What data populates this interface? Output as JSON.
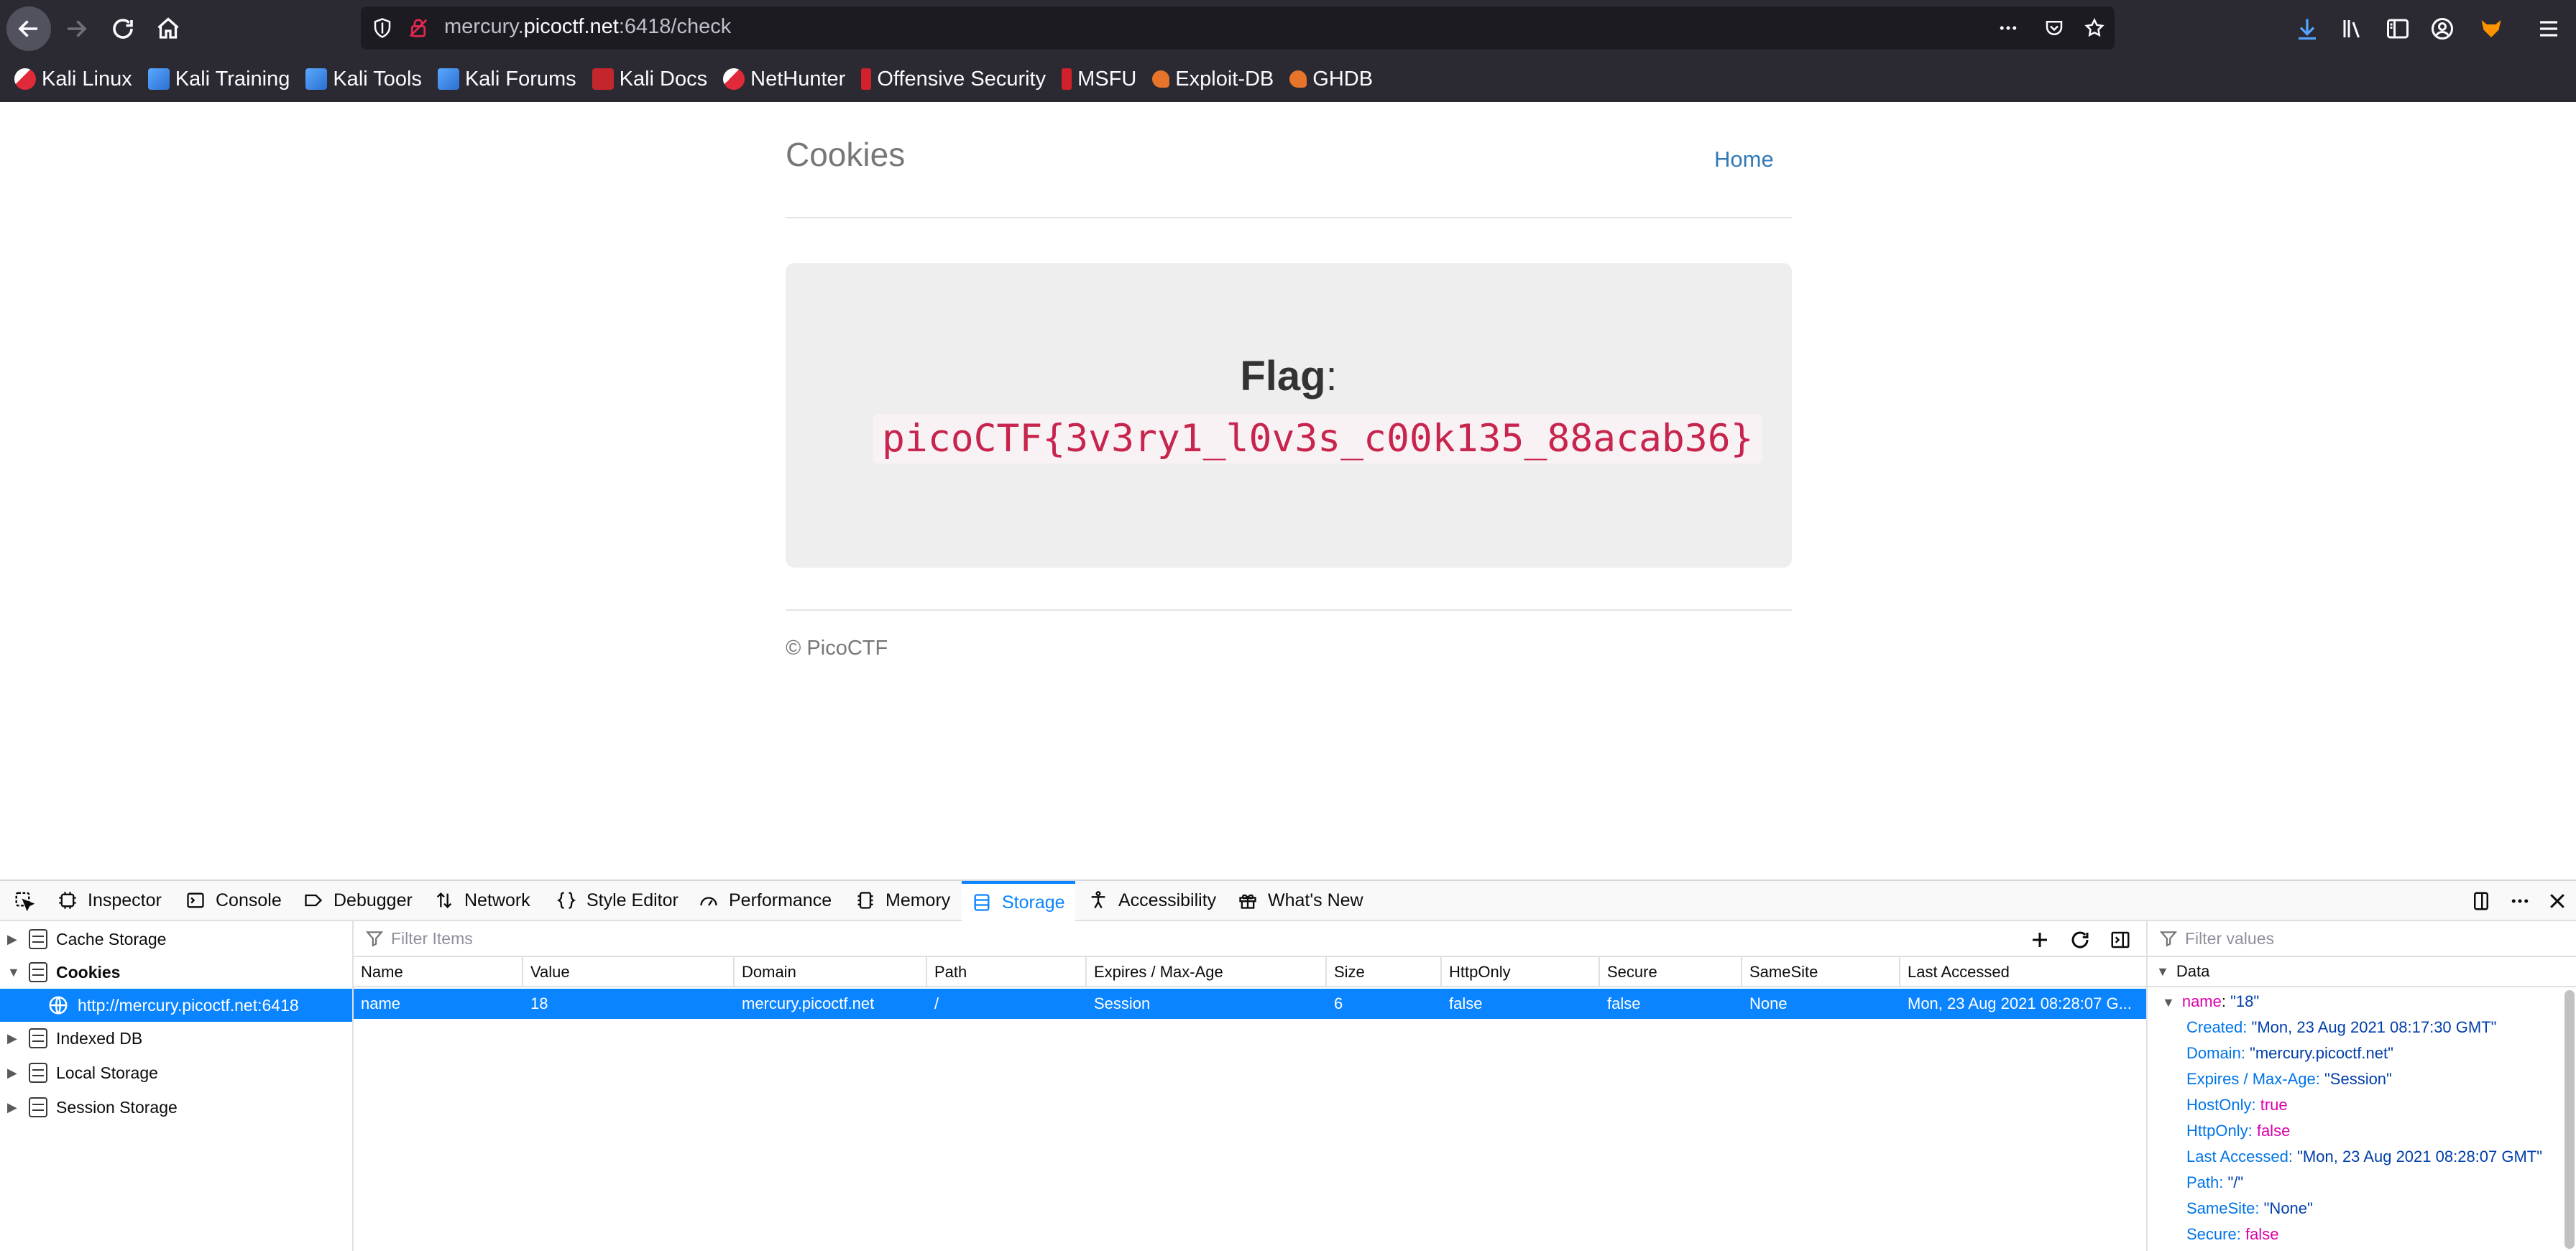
{
  "browser": {
    "url_prefix": "mercury.",
    "url_domain": "picoctf.net",
    "url_suffix": ":6418/check",
    "bookmarks": [
      {
        "label": "Kali Linux",
        "icon": "kali-dragon-icon"
      },
      {
        "label": "Kali Training",
        "icon": "kali-training-icon"
      },
      {
        "label": "Kali Tools",
        "icon": "kali-tools-icon"
      },
      {
        "label": "Kali Forums",
        "icon": "kali-forums-icon"
      },
      {
        "label": "Kali Docs",
        "icon": "kali-docs-icon"
      },
      {
        "label": "NetHunter",
        "icon": "nethunter-icon"
      },
      {
        "label": "Offensive Security",
        "icon": "offsec-icon"
      },
      {
        "label": "MSFU",
        "icon": "msfu-icon"
      },
      {
        "label": "Exploit-DB",
        "icon": "exploit-db-icon"
      },
      {
        "label": "GHDB",
        "icon": "ghdb-icon"
      }
    ]
  },
  "page": {
    "site_title": "Cookies",
    "nav_home": "Home",
    "flag_label": "Flag",
    "flag_colon": ":",
    "flag_value": "picoCTF{3v3ry1_l0v3s_c00k135_88acab36}",
    "footer": "© PicoCTF"
  },
  "devtools": {
    "tabs": [
      {
        "label": "Inspector",
        "icon": "inspector-icon"
      },
      {
        "label": "Console",
        "icon": "console-icon"
      },
      {
        "label": "Debugger",
        "icon": "debugger-icon"
      },
      {
        "label": "Network",
        "icon": "network-icon"
      },
      {
        "label": "Style Editor",
        "icon": "style-editor-icon"
      },
      {
        "label": "Performance",
        "icon": "performance-icon"
      },
      {
        "label": "Memory",
        "icon": "memory-icon"
      },
      {
        "label": "Storage",
        "icon": "storage-icon",
        "active": true
      },
      {
        "label": "Accessibility",
        "icon": "accessibility-icon"
      },
      {
        "label": "What's New",
        "icon": "whats-new-icon"
      }
    ],
    "sidebar": {
      "cache_storage": "Cache Storage",
      "cookies": "Cookies",
      "cookie_origin": "http://mercury.picoctf.net:6418",
      "indexed_db": "Indexed DB",
      "local_storage": "Local Storage",
      "session_storage": "Session Storage"
    },
    "filter_placeholder": "Filter Items",
    "data_filter_placeholder": "Filter values",
    "columns": [
      "Name",
      "Value",
      "Domain",
      "Path",
      "Expires / Max-Age",
      "Size",
      "HttpOnly",
      "Secure",
      "SameSite",
      "Last Accessed"
    ],
    "rows": [
      [
        "name",
        "18",
        "mercury.picoctf.net",
        "/",
        "Session",
        "6",
        "false",
        "false",
        "None",
        "Mon, 23 Aug 2021 08:28:07 G..."
      ]
    ],
    "data_panel": {
      "heading": "Data",
      "root_key": "name",
      "root_value": "\"18\"",
      "props": [
        {
          "key": "Created",
          "value": "\"Mon, 23 Aug 2021 08:17:30 GMT\"",
          "kind": "str"
        },
        {
          "key": "Domain",
          "value": "\"mercury.picoctf.net\"",
          "kind": "str"
        },
        {
          "key": "Expires / Max-Age",
          "value": "\"Session\"",
          "kind": "str"
        },
        {
          "key": "HostOnly",
          "value": "true",
          "kind": "bool"
        },
        {
          "key": "HttpOnly",
          "value": "false",
          "kind": "bool"
        },
        {
          "key": "Last Accessed",
          "value": "\"Mon, 23 Aug 2021 08:28:07 GMT\"",
          "kind": "str"
        },
        {
          "key": "Path",
          "value": "\"/\"",
          "kind": "str"
        },
        {
          "key": "SameSite",
          "value": "\"None\"",
          "kind": "str"
        },
        {
          "key": "Secure",
          "value": "false",
          "kind": "bool"
        }
      ]
    }
  },
  "colors": {
    "chrome_bg": "#2b2a33",
    "accent": "#0a84ff",
    "flag_text": "#c7254e",
    "link": "#337ab7"
  }
}
